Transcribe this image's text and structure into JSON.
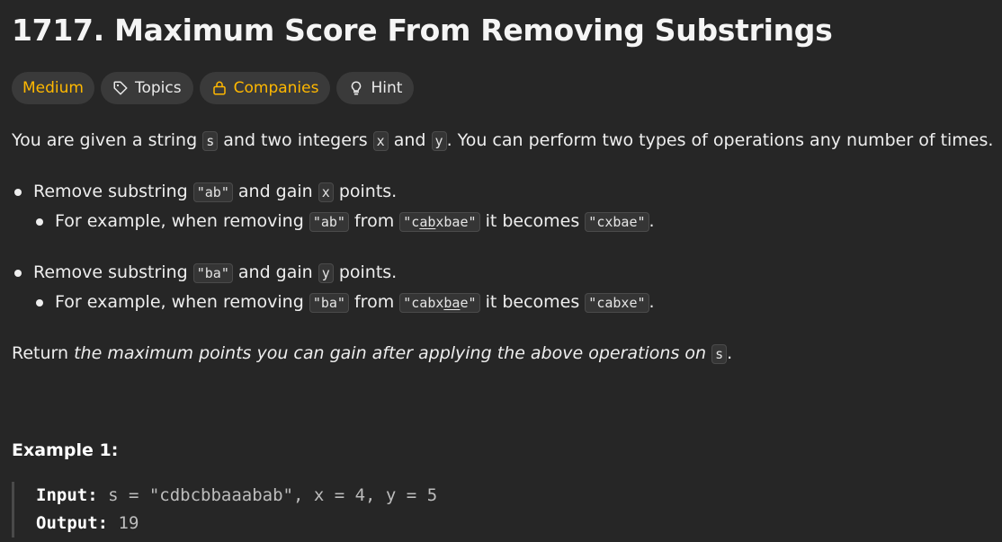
{
  "problem": {
    "title": "1717. Maximum Score From Removing Substrings"
  },
  "tags": {
    "difficulty": "Medium",
    "topics": "Topics",
    "companies": "Companies",
    "hint": "Hint"
  },
  "description": {
    "p1_a": "You are given a string ",
    "p1_code_s": "s",
    "p1_b": " and two integers ",
    "p1_code_x": "x",
    "p1_c": " and ",
    "p1_code_y": "y",
    "p1_d": ". You can perform two types of operations any number of times.",
    "op1": {
      "a": "Remove substring ",
      "code": "\"ab\"",
      "b": " and gain ",
      "code_x": "x",
      "c": " points.",
      "ex_a": "For example, when removing ",
      "ex_code1": "\"ab\"",
      "ex_b": " from ",
      "ex_code2_pre": "\"c",
      "ex_code2_u": "ab",
      "ex_code2_post": "xbae\"",
      "ex_c": " it becomes ",
      "ex_code3": "\"cxbae\"",
      "ex_d": "."
    },
    "op2": {
      "a": "Remove substring ",
      "code": "\"ba\"",
      "b": " and gain ",
      "code_y": "y",
      "c": " points.",
      "ex_a": "For example, when removing ",
      "ex_code1": "\"ba\"",
      "ex_b": " from ",
      "ex_code2_pre": "\"cabx",
      "ex_code2_u": "ba",
      "ex_code2_post": "e\"",
      "ex_c": " it becomes ",
      "ex_code3": "\"cabxe\"",
      "ex_d": "."
    },
    "p2_a": "Return ",
    "p2_em": "the maximum points you can gain after applying the above operations on",
    "p2_b": " ",
    "p2_code_s": "s",
    "p2_c": "."
  },
  "example1": {
    "title": "Example 1:",
    "input_label": "Input:",
    "input_value": " s = \"cdbcbbaaabab\", x = 4, y = 5",
    "output_label": "Output:",
    "output_value": " 19"
  },
  "colors": {
    "background": "#262626",
    "difficulty_medium": "#ffb800",
    "tag_bg": "#3a3a3a"
  },
  "icons": {
    "topics": "tag-icon",
    "companies": "lock-icon",
    "hint": "lightbulb-icon"
  }
}
